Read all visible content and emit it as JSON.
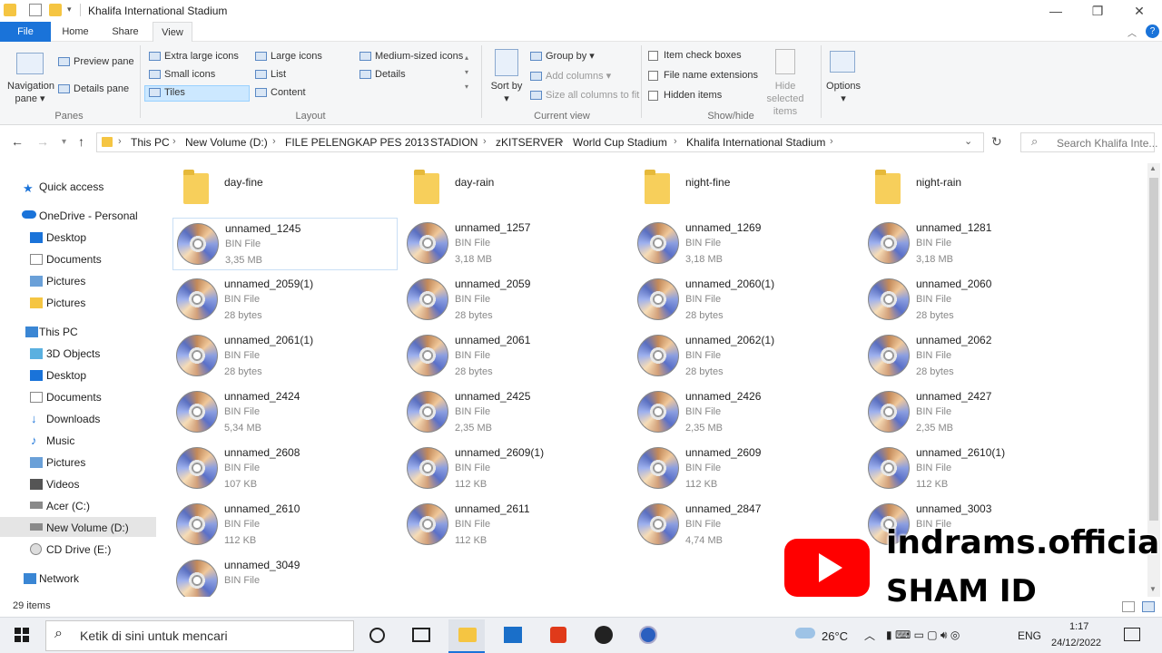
{
  "window": {
    "title": "Khalifa International Stadium"
  },
  "tabs": {
    "file": "File",
    "home": "Home",
    "share": "Share",
    "view": "View"
  },
  "ribbon": {
    "navigation_pane": "Navigation pane",
    "preview_pane": "Preview pane",
    "details_pane": "Details pane",
    "panes_group": "Panes",
    "extra_large_icons": "Extra large icons",
    "large_icons": "Large icons",
    "medium_icons": "Medium-sized icons",
    "small_icons": "Small icons",
    "list": "List",
    "details": "Details",
    "tiles": "Tiles",
    "content": "Content",
    "layout_group": "Layout",
    "sort_by": "Sort by",
    "group_by": "Group by",
    "add_columns": "Add columns",
    "size_columns": "Size all columns to fit",
    "current_view_group": "Current view",
    "item_check_boxes": "Item check boxes",
    "file_name_extensions": "File name extensions",
    "hidden_items": "Hidden items",
    "hide_selected": "Hide selected items",
    "show_hide_group": "Show/hide",
    "options": "Options"
  },
  "address": {
    "crumbs": [
      "This PC",
      "New Volume (D:)",
      "FILE PELENGKAP PES 2013",
      "STADION",
      "zKITSERVER",
      "World Cup Stadium",
      "Khalifa International Stadium"
    ],
    "search_placeholder": "Search Khalifa Inte..."
  },
  "sidebar": {
    "quick_access": "Quick access",
    "onedrive": "OneDrive - Personal",
    "od_desktop": "Desktop",
    "od_documents": "Documents",
    "od_pictures": "Pictures",
    "od_pictures2": "Pictures",
    "this_pc": "This PC",
    "objects3d": "3D Objects",
    "desktop": "Desktop",
    "documents": "Documents",
    "downloads": "Downloads",
    "music": "Music",
    "pictures": "Pictures",
    "videos": "Videos",
    "acer": "Acer (C:)",
    "new_volume": "New Volume (D:)",
    "cd_drive": "CD Drive (E:)",
    "network": "Network"
  },
  "folders": [
    {
      "name": "day-fine"
    },
    {
      "name": "day-rain"
    },
    {
      "name": "night-fine"
    },
    {
      "name": "night-rain"
    }
  ],
  "files": [
    {
      "name": "unnamed_1245",
      "type": "BIN File",
      "size": "3,35 MB"
    },
    {
      "name": "unnamed_1257",
      "type": "BIN File",
      "size": "3,18 MB"
    },
    {
      "name": "unnamed_1269",
      "type": "BIN File",
      "size": "3,18 MB"
    },
    {
      "name": "unnamed_1281",
      "type": "BIN File",
      "size": "3,18 MB"
    },
    {
      "name": "unnamed_2059(1)",
      "type": "BIN File",
      "size": "28 bytes"
    },
    {
      "name": "unnamed_2059",
      "type": "BIN File",
      "size": "28 bytes"
    },
    {
      "name": "unnamed_2060(1)",
      "type": "BIN File",
      "size": "28 bytes"
    },
    {
      "name": "unnamed_2060",
      "type": "BIN File",
      "size": "28 bytes"
    },
    {
      "name": "unnamed_2061(1)",
      "type": "BIN File",
      "size": "28 bytes"
    },
    {
      "name": "unnamed_2061",
      "type": "BIN File",
      "size": "28 bytes"
    },
    {
      "name": "unnamed_2062(1)",
      "type": "BIN File",
      "size": "28 bytes"
    },
    {
      "name": "unnamed_2062",
      "type": "BIN File",
      "size": "28 bytes"
    },
    {
      "name": "unnamed_2424",
      "type": "BIN File",
      "size": "5,34 MB"
    },
    {
      "name": "unnamed_2425",
      "type": "BIN File",
      "size": "2,35 MB"
    },
    {
      "name": "unnamed_2426",
      "type": "BIN File",
      "size": "2,35 MB"
    },
    {
      "name": "unnamed_2427",
      "type": "BIN File",
      "size": "2,35 MB"
    },
    {
      "name": "unnamed_2608",
      "type": "BIN File",
      "size": "107 KB"
    },
    {
      "name": "unnamed_2609(1)",
      "type": "BIN File",
      "size": "112 KB"
    },
    {
      "name": "unnamed_2609",
      "type": "BIN File",
      "size": "112 KB"
    },
    {
      "name": "unnamed_2610(1)",
      "type": "BIN File",
      "size": "112 KB"
    },
    {
      "name": "unnamed_2610",
      "type": "BIN File",
      "size": "112 KB"
    },
    {
      "name": "unnamed_2611",
      "type": "BIN File",
      "size": "112 KB"
    },
    {
      "name": "unnamed_2847",
      "type": "BIN File",
      "size": "4,74 MB"
    },
    {
      "name": "unnamed_3003",
      "type": "BIN File",
      "size": ""
    },
    {
      "name": "unnamed_3049",
      "type": "BIN File",
      "size": ""
    }
  ],
  "status": {
    "item_count": "29 items"
  },
  "taskbar": {
    "search_placeholder": "Ketik di sini untuk mencari",
    "weather": "26°C",
    "language": "ENG",
    "time": "1:17",
    "date": "24/12/2022"
  },
  "watermark": {
    "line1": "indrams.official",
    "line2": "SHAM ID"
  }
}
